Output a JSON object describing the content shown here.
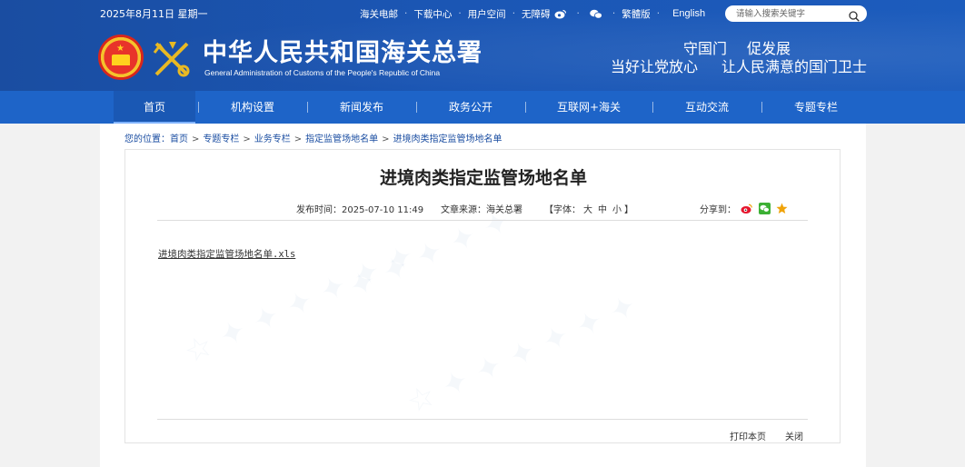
{
  "header": {
    "date": "2025年8月11日 星期一",
    "links": [
      "海关电邮",
      "下载中心",
      "用户空间",
      "无障碍"
    ],
    "traditional": "繁體版",
    "english": "English",
    "search_placeholder": "请输入搜索关键字",
    "title_cn": "中华人民共和国海关总署",
    "title_en": "General Administration of Customs of the People's Republic of China",
    "slogan_line1": [
      "守国门",
      "促发展"
    ],
    "slogan_line2": [
      "当好让党放心",
      "让人民满意的国门卫士"
    ]
  },
  "nav": {
    "items": [
      "首页",
      "机构设置",
      "新闻发布",
      "政务公开",
      "互联网+海关",
      "互动交流",
      "专题专栏"
    ],
    "active_index": 0
  },
  "breadcrumb": {
    "label": "您的位置：",
    "items": [
      "首页",
      "专题专栏",
      "业务专栏",
      "指定监管场地名单",
      "进境肉类指定监管场地名单"
    ]
  },
  "article": {
    "title": "进境肉类指定监管场地名单",
    "publish_time": "发布时间：2025-07-10 11:49",
    "source": "文章来源：海关总署",
    "font_prefix": "【字体：",
    "font_sizes": [
      "大",
      "中",
      "小"
    ],
    "font_suffix": "】",
    "share_label": "分享到：",
    "attachment": "进境肉类指定监管场地名单.xls",
    "print": "打印本页",
    "close": "关闭"
  },
  "colors": {
    "header_blue": "#1b56b4",
    "nav_blue": "#1e64c8",
    "weibo_red": "#e6162d",
    "wechat_green": "#3cb034",
    "star_gold": "#f0a30a"
  }
}
